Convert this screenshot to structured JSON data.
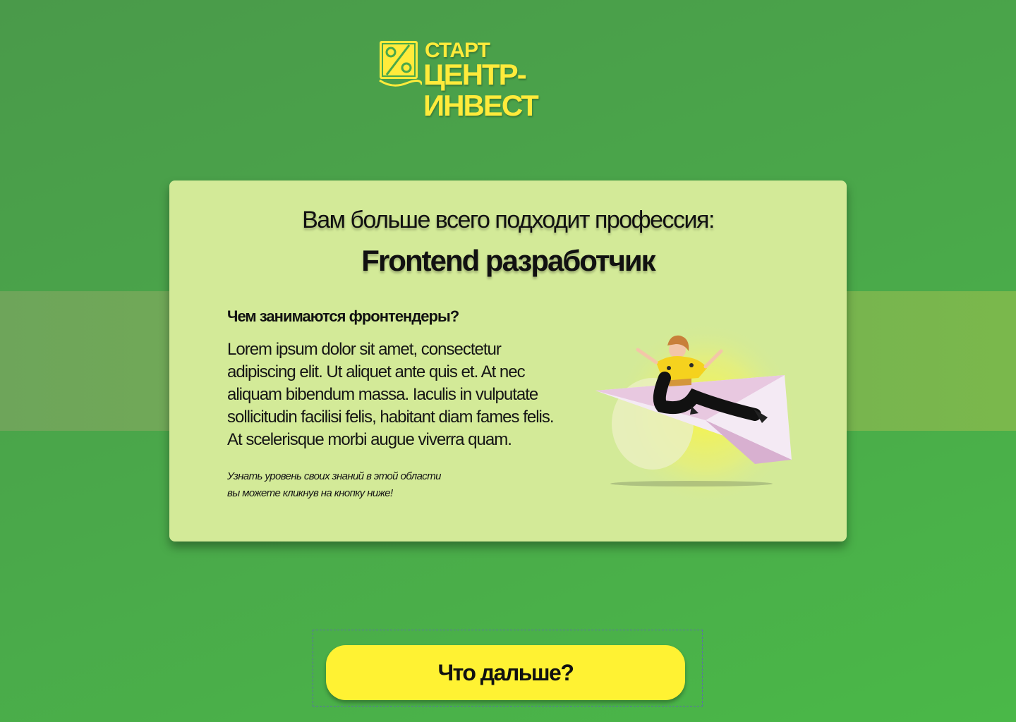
{
  "logo": {
    "line1": "СТАРТ",
    "line2": "ЦЕНТР-ИНВЕСТ",
    "icon": "percent-logo-icon",
    "color": "#ffeb3b"
  },
  "card": {
    "heading": "Вам больше всего подходит профессия:",
    "profession": "Frontend разработчик",
    "question_title": "Чем занимаются фронтендеры?",
    "question_body": "Lorem ipsum dolor sit amet, consectetur adipiscing elit. Ut aliquet ante quis et. At nec aliquam bibendum massa. Iaculis in vulputate sollicitudin facilisi felis, habitant diam fames felis. At scelerisque morbi augue viverra quam.",
    "note_line1": "Узнать уровень своих знаний в этой области",
    "note_line2": "вы можете кликнув на кнопку ниже!",
    "illustration": "person-on-paper-plane-illustration",
    "background": "#d3ea98"
  },
  "cta": {
    "label": "Что дальше?",
    "color": "#fff233"
  },
  "theme": {
    "background_green": "#4aa84a"
  }
}
